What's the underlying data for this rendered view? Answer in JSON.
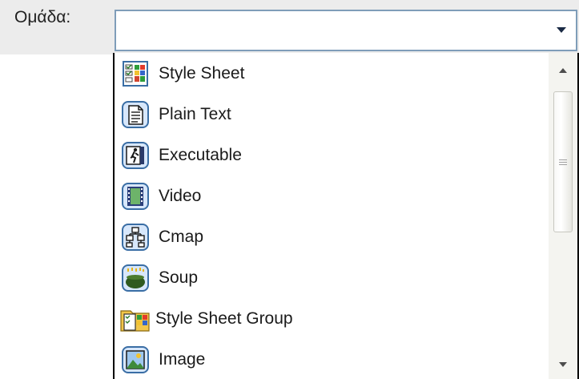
{
  "field": {
    "label": "Ομάδα:",
    "value": ""
  },
  "dropdown": {
    "items": [
      {
        "label": "Style Sheet",
        "icon": "style-sheet-icon"
      },
      {
        "label": "Plain Text",
        "icon": "plain-text-icon"
      },
      {
        "label": "Executable",
        "icon": "executable-icon"
      },
      {
        "label": "Video",
        "icon": "video-icon"
      },
      {
        "label": "Cmap",
        "icon": "cmap-icon"
      },
      {
        "label": "Soup",
        "icon": "soup-icon"
      },
      {
        "label": "Style Sheet Group",
        "icon": "style-sheet-group-icon"
      },
      {
        "label": "Image",
        "icon": "image-icon"
      }
    ]
  },
  "colors": {
    "band": "#ececec",
    "combo_border": "#7f9db9",
    "dropdown_border": "#000000",
    "icon_blue": "#3a6ea5"
  }
}
